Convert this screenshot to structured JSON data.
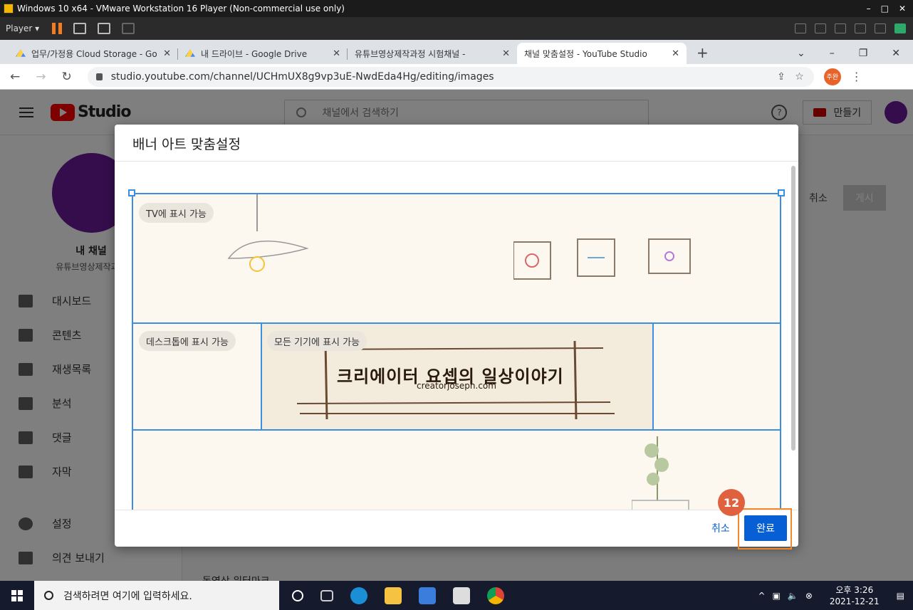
{
  "vm": {
    "title": "Windows 10 x64 - VMware Workstation 16 Player (Non-commercial use only)",
    "player_label": "Player",
    "win_controls": [
      "–",
      "□",
      "✕"
    ]
  },
  "browser": {
    "tabs": [
      {
        "label": "업무/가정용 Cloud Storage - Go",
        "icon": "google-drive-icon"
      },
      {
        "label": "내 드라이브 - Google Drive",
        "icon": "google-drive-icon"
      },
      {
        "label": "유튜브영상제작과정 시험채널 -",
        "icon": "youtube-icon"
      },
      {
        "label": "채널 맞춤설정 - YouTube Studio",
        "icon": "youtube-icon",
        "active": true
      }
    ],
    "new_tab": "+",
    "url": "studio.youtube.com/channel/UCHmUX8g9vp3uE-NwdEda4Hg/editing/images",
    "profile_badge": "주완"
  },
  "studio": {
    "logo_text": "Studio",
    "search_placeholder": "채널에서 검색하기",
    "create_label": "만들기",
    "channel_name": "내 채널",
    "channel_sub": "유튜브영상제작과정",
    "nav": [
      {
        "label": "대시보드",
        "icon": "dashboard-icon"
      },
      {
        "label": "콘텐츠",
        "icon": "content-icon"
      },
      {
        "label": "재생목록",
        "icon": "playlist-icon"
      },
      {
        "label": "분석",
        "icon": "analytics-icon"
      },
      {
        "label": "댓글",
        "icon": "comments-icon"
      },
      {
        "label": "자막",
        "icon": "subtitles-icon"
      }
    ],
    "bottom_nav": [
      {
        "label": "설정",
        "icon": "settings-icon"
      },
      {
        "label": "의견 보내기",
        "icon": "feedback-icon"
      }
    ],
    "behind_cancel": "취소",
    "behind_publish": "게시",
    "behind_text": "동영상 워터마크"
  },
  "dialog": {
    "title": "배너 아트 맞춤설정",
    "zones": {
      "tv": "TV에 표시 가능",
      "desktop": "데스크톱에 표시 가능",
      "all": "모든 기기에 표시 가능"
    },
    "banner_text": "크리에이터 요셉의 일상이야기",
    "banner_url": "creatorjoseph.com",
    "cancel_label": "취소",
    "done_label": "완료"
  },
  "annotation": {
    "step": "12",
    "color": "#f08a2a",
    "badge_color": "#e0613e"
  },
  "taskbar": {
    "search_placeholder": "검색하려면 여기에 입력하세요.",
    "time": "오후 3:26",
    "date": "2021-12-21"
  }
}
